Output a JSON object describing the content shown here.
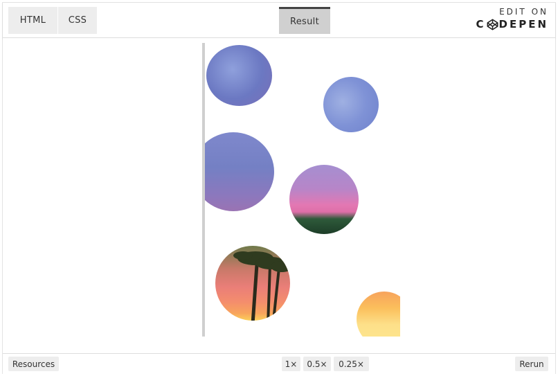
{
  "tabs": {
    "html": "HTML",
    "css": "CSS",
    "result": "Result"
  },
  "brand": {
    "top": "EDIT ON",
    "bottom_left": "C",
    "bottom_right": "DEPEN"
  },
  "bottom": {
    "resources": "Resources",
    "zoom": [
      "1×",
      "0.5×",
      "0.25×"
    ],
    "rerun": "Rerun"
  },
  "colors": {
    "active_tab_border": "#444444",
    "tab_bg": "#ededed",
    "active_tab_bg": "#d0d0d0"
  }
}
